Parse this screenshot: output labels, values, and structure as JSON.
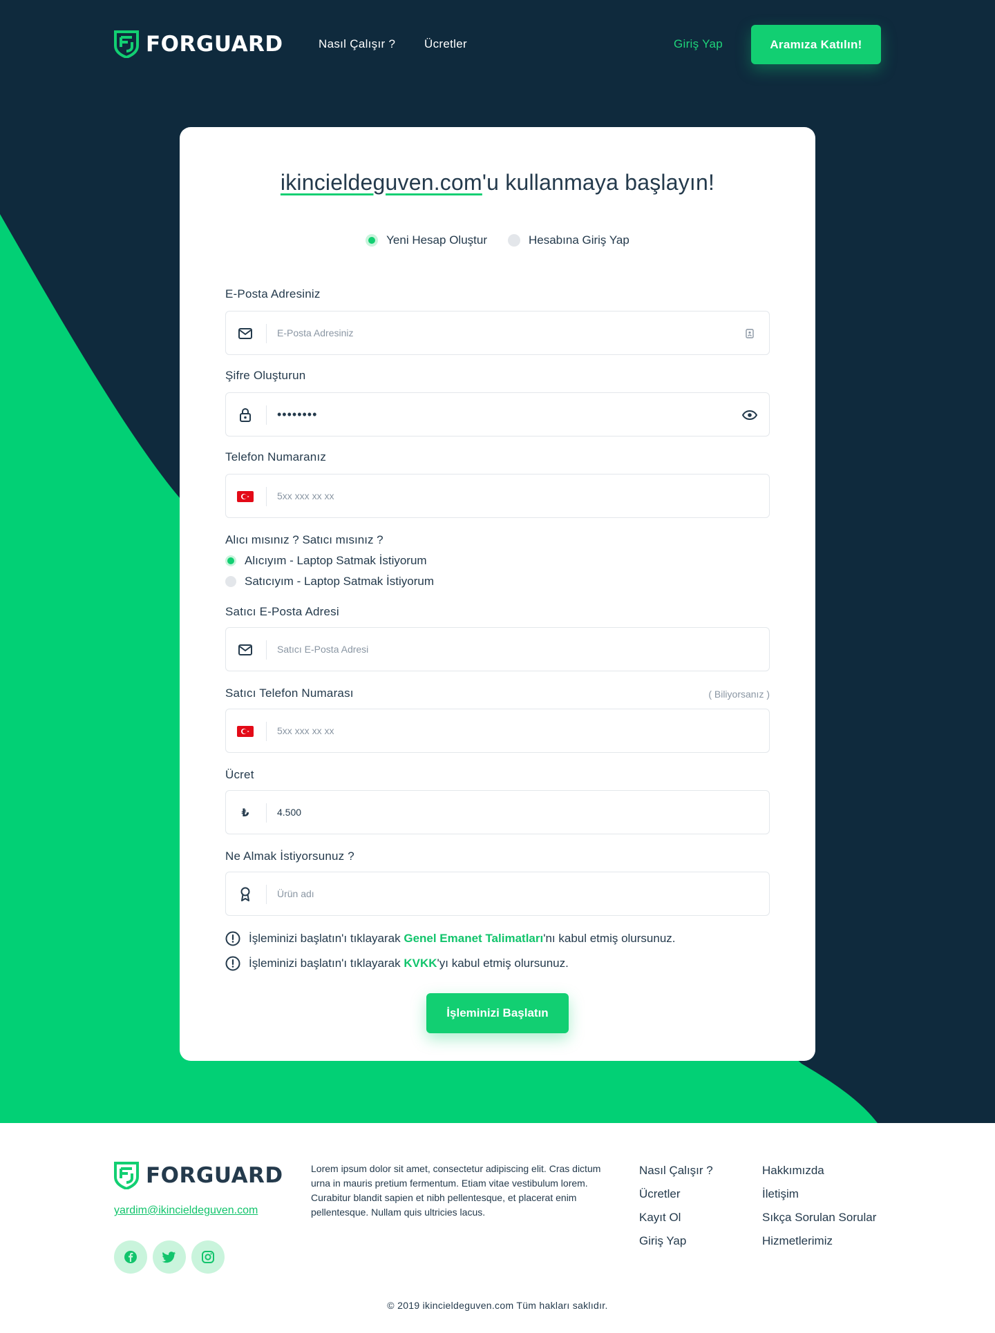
{
  "header": {
    "brand": "FORGUARD",
    "nav": [
      "Nasıl Çalışır ?",
      "Ücretler"
    ],
    "login_label": "Giriş Yap",
    "join_label": "Aramıza Katılın!"
  },
  "card": {
    "title_site": "ikincieldeguven.com",
    "title_rest": "'u kullanmaya başlayın!",
    "modes": [
      {
        "label": "Yeni Hesap Oluştur",
        "selected": true
      },
      {
        "label": "Hesabına Giriş Yap",
        "selected": false
      }
    ],
    "email": {
      "label": "E-Posta Adresiniz",
      "placeholder": "E-Posta Adresiniz",
      "value": ""
    },
    "password": {
      "label": "Şifre Oluşturun",
      "value": "password"
    },
    "phone": {
      "label": "Telefon Numaranız",
      "placeholder": "5xx xxx xx xx",
      "value": ""
    },
    "role": {
      "question": "Alıcı mısınız ? Satıcı mısınız ?",
      "options": [
        {
          "label": "Alıcıyım - Laptop Satmak İstiyorum",
          "selected": true
        },
        {
          "label": "Satıcıyım - Laptop Satmak İstiyorum",
          "selected": false
        }
      ]
    },
    "seller_email": {
      "label": "Satıcı E-Posta Adresi",
      "placeholder": "Satıcı E-Posta Adresi",
      "value": ""
    },
    "seller_phone": {
      "label": "Satıcı Telefon Numarası",
      "hint": "( Biliyorsanız )",
      "placeholder": "5xx xxx xx xx",
      "value": ""
    },
    "price": {
      "label": "Ücret",
      "currency_icon": "₺",
      "value": "4.500"
    },
    "product": {
      "label": "Ne Almak İstiyorsunuz ?",
      "placeholder": "Ürün adı",
      "value": ""
    },
    "notices": [
      {
        "before": "İşleminizi başlatın'ı tıklayarak ",
        "link": "Genel Emanet Talimatları",
        "after": "'nı kabul etmiş olursunuz."
      },
      {
        "before": "İşleminizi başlatın'ı tıklayarak ",
        "link": "KVKK",
        "after": "'yı kabul etmiş olursunuz."
      }
    ],
    "submit_label": "İşleminizi Başlatın"
  },
  "footer": {
    "brand": "FORGUARD",
    "email": "yardim@ikincieldeguven.com",
    "socials": [
      "facebook-icon",
      "twitter-icon",
      "instagram-icon"
    ],
    "text": "Lorem ipsum dolor sit amet, consectetur adipiscing elit. Cras dictum urna in mauris pretium fermentum. Etiam vitae vestibulum lorem. Curabitur blandit sapien et nibh pellentesque, et placerat enim pellentesque. Nullam quis ultricies lacus.",
    "col1": [
      "Nasıl Çalışır ?",
      "Ücretler",
      "Kayıt Ol",
      "Giriş Yap"
    ],
    "col2": [
      "Hakkımızda",
      "İletişim",
      "Sıkça Sorulan Sorular",
      "Hizmetlerimiz"
    ],
    "copyright": "© 2019 ikincieldeguven.com Tüm hakları saklıdır."
  },
  "colors": {
    "dark": "#0f2a3d",
    "accent": "#12cf72",
    "text": "#243a4c"
  }
}
